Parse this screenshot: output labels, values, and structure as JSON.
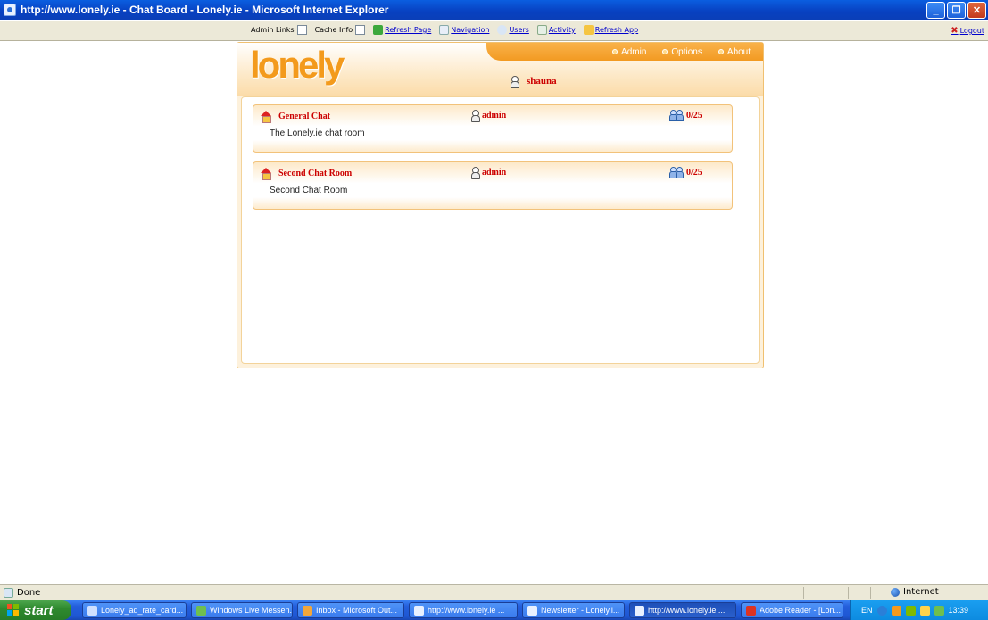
{
  "window": {
    "title": "http://www.lonely.ie - Chat Board - Lonely.ie - Microsoft Internet Explorer"
  },
  "adminbar": {
    "admin_links_label": "Admin Links",
    "cache_info_label": "Cache Info",
    "links": [
      "Refresh Page",
      "Navigation",
      "Users",
      "Activity",
      "Refresh App"
    ],
    "logout": "Logout"
  },
  "app": {
    "logo": "lonely",
    "nav": [
      "Admin",
      "Options",
      "About"
    ],
    "user": "shauna",
    "rooms": [
      {
        "name": "General Chat",
        "description": "The Lonely.ie chat room",
        "owner": "admin",
        "occupancy": "0/25"
      },
      {
        "name": "Second Chat Room",
        "description": "Second Chat Room",
        "owner": "admin",
        "occupancy": "0/25"
      }
    ]
  },
  "statusbar": {
    "status": "Done",
    "zone": "Internet"
  },
  "taskbar": {
    "start": "start",
    "tasks": [
      "Lonely_ad_rate_card...",
      "Windows Live Messen...",
      "Inbox - Microsoft Out...",
      "http://www.lonely.ie ...",
      "Newsletter - Lonely.i...",
      "http://www.lonely.ie ...",
      "Adobe Reader - [Lon..."
    ],
    "lang": "EN",
    "clock": "13:39"
  },
  "colors": {
    "accent": "#f29a22",
    "link": "#0000cc",
    "room_title": "#cc0000",
    "titlebar": "#0a5ee0"
  }
}
